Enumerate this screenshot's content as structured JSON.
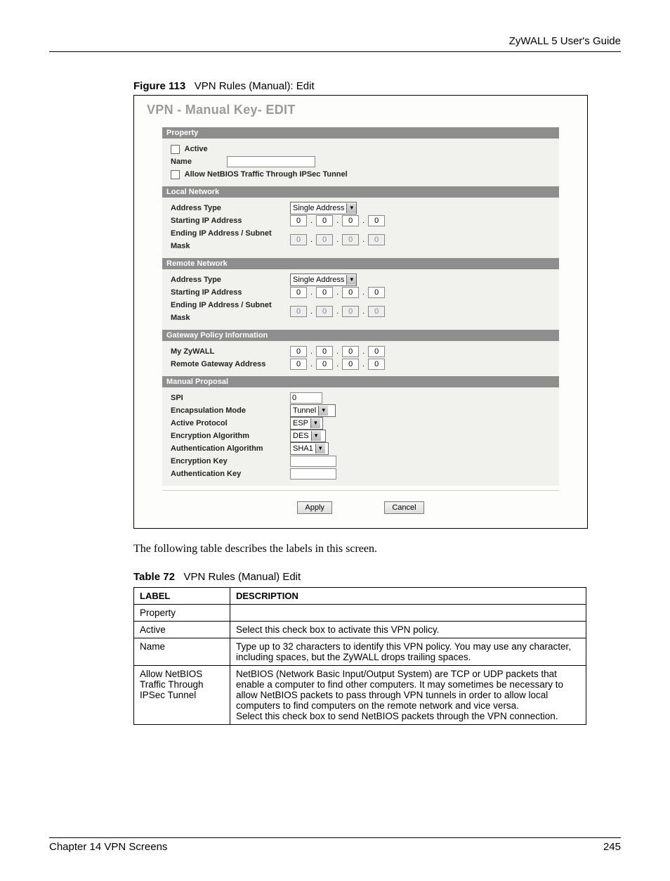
{
  "header": {
    "guide": "ZyWALL 5 User's Guide"
  },
  "figure": {
    "label": "Figure 113",
    "title": "VPN Rules (Manual): Edit"
  },
  "screen": {
    "title": "VPN - Manual Key- EDIT",
    "sections": {
      "property": {
        "header": "Property",
        "active": "Active",
        "name_label": "Name",
        "name_value": "",
        "netbios": "Allow NetBIOS Traffic Through IPSec Tunnel"
      },
      "local": {
        "header": "Local Network",
        "addr_type_label": "Address Type",
        "addr_type_value": "Single Address",
        "start_ip_label": "Starting IP Address",
        "end_ip_label": "Ending IP Address / Subnet Mask",
        "start_ip": [
          "0",
          "0",
          "0",
          "0"
        ],
        "end_ip": [
          "0",
          "0",
          "0",
          "0"
        ]
      },
      "remote": {
        "header": "Remote Network",
        "addr_type_label": "Address Type",
        "addr_type_value": "Single Address",
        "start_ip_label": "Starting IP Address",
        "end_ip_label": "Ending IP Address / Subnet Mask",
        "start_ip": [
          "0",
          "0",
          "0",
          "0"
        ],
        "end_ip": [
          "0",
          "0",
          "0",
          "0"
        ]
      },
      "gateway": {
        "header": "Gateway Policy Information",
        "my_label": "My ZyWALL",
        "remote_label": "Remote Gateway Address",
        "my_ip": [
          "0",
          "0",
          "0",
          "0"
        ],
        "remote_ip": [
          "0",
          "0",
          "0",
          "0"
        ]
      },
      "manual": {
        "header": "Manual Proposal",
        "spi_label": "SPI",
        "spi_value": "0",
        "encap_label": "Encapsulation Mode",
        "encap_value": "Tunnel",
        "proto_label": "Active Protocol",
        "proto_value": "ESP",
        "enc_alg_label": "Encryption Algorithm",
        "enc_alg_value": "DES",
        "auth_alg_label": "Authentication Algorithm",
        "auth_alg_value": "SHA1",
        "enc_key_label": "Encryption Key",
        "enc_key_value": "",
        "auth_key_label": "Authentication Key",
        "auth_key_value": ""
      }
    },
    "buttons": {
      "apply": "Apply",
      "cancel": "Cancel"
    }
  },
  "paragraph": "The following table describes the labels in this screen.",
  "table": {
    "label": "Table 72",
    "title": "VPN Rules (Manual) Edit",
    "headers": {
      "label": "LABEL",
      "desc": "DESCRIPTION"
    },
    "rows": [
      {
        "label": "Property",
        "desc": ""
      },
      {
        "label": "Active",
        "desc": "Select this check box to activate this VPN policy."
      },
      {
        "label": "Name",
        "desc": "Type up to 32 characters to identify this VPN policy. You may use any character, including spaces, but the ZyWALL drops trailing spaces."
      },
      {
        "label": "Allow NetBIOS Traffic Through IPSec Tunnel",
        "desc": "NetBIOS (Network Basic Input/Output System) are TCP or UDP packets that enable a computer to find other computers. It may sometimes be necessary to allow NetBIOS packets to pass through VPN tunnels in order to allow local computers to find computers on the remote network and vice versa.\nSelect this check box to send NetBIOS packets through the VPN connection."
      }
    ]
  },
  "footer": {
    "chapter": "Chapter 14 VPN Screens",
    "page": "245"
  }
}
